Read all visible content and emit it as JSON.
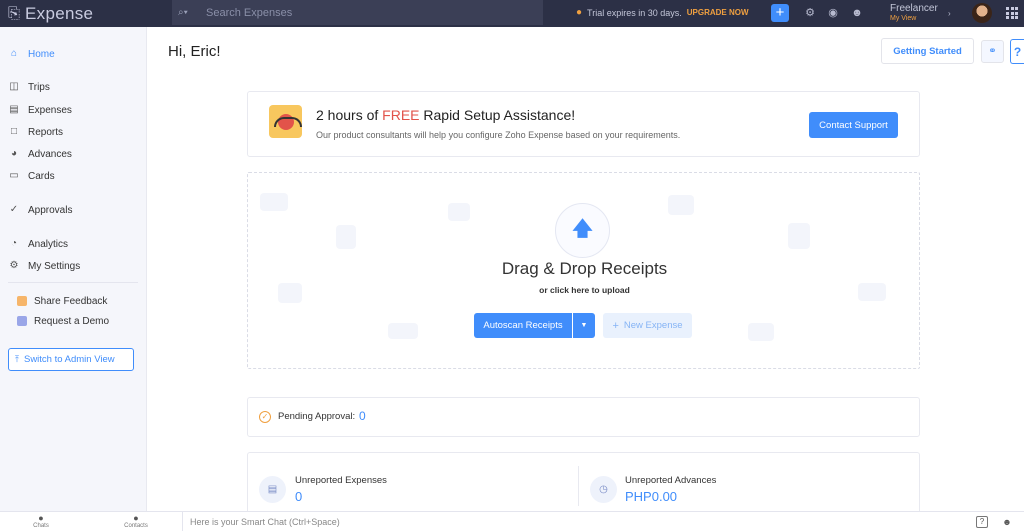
{
  "app": {
    "name": "Expense",
    "search_placeholder": "Search Expenses",
    "trial_text": "Trial expires in 30 days.",
    "upgrade_label": "UPGRADE NOW",
    "org_name": "Freelancer",
    "org_view": "My View",
    "accent_color": "#408dfb",
    "topbar_color": "#2c3046"
  },
  "sidebar": {
    "items": [
      {
        "label": "Home",
        "icon": "home-icon",
        "active": true
      },
      {
        "label": "Trips",
        "icon": "trips-icon"
      },
      {
        "label": "Expenses",
        "icon": "expenses-icon"
      },
      {
        "label": "Reports",
        "icon": "reports-icon"
      },
      {
        "label": "Advances",
        "icon": "advances-icon"
      },
      {
        "label": "Cards",
        "icon": "cards-icon"
      },
      {
        "label": "Approvals",
        "icon": "approvals-icon"
      },
      {
        "label": "Analytics",
        "icon": "analytics-icon"
      },
      {
        "label": "My Settings",
        "icon": "settings-icon"
      }
    ],
    "promo": [
      {
        "label": "Share Feedback",
        "icon": "feedback-icon"
      },
      {
        "label": "Request a Demo",
        "icon": "demo-icon"
      }
    ],
    "admin_button": "Switch to Admin View"
  },
  "main": {
    "greeting": "Hi, Eric!",
    "getting_started": "Getting Started",
    "help": "?",
    "assist": {
      "title_pre": "2 hours of ",
      "title_free": "FREE",
      "title_post": " Rapid Setup Assistance!",
      "subtitle": "Our product consultants will help you configure Zoho Expense based on your requirements.",
      "button": "Contact Support"
    },
    "dropzone": {
      "title": "Drag & Drop Receipts",
      "subtitle": "or click here to upload",
      "autoscan": "Autoscan Receipts",
      "new_expense": "New Expense"
    },
    "pending": {
      "label": "Pending Approval:",
      "value": "0"
    },
    "unreported": {
      "expenses_label": "Unreported Expenses",
      "expenses_value": "0",
      "advances_label": "Unreported Advances",
      "advances_value": "PHP0.00"
    }
  },
  "bottombar": {
    "chats": "Chats",
    "contacts": "Contacts",
    "smart_chat": "Here is your Smart Chat (Ctrl+Space)"
  }
}
